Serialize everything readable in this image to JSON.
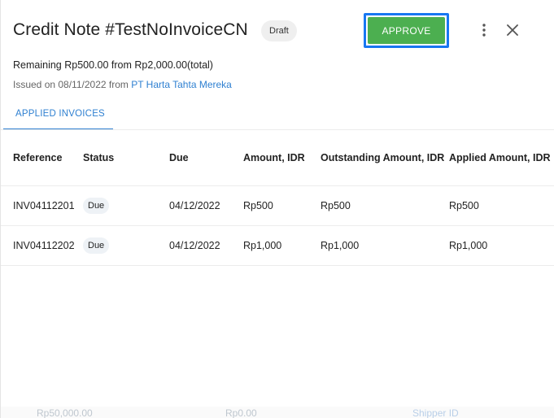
{
  "header": {
    "title": "Credit Note #TestNoInvoiceCN",
    "status_badge": "Draft",
    "approve_label": "APPROVE"
  },
  "summary": {
    "remaining": "Remaining Rp500.00 from Rp2,000.00(total)",
    "issued_prefix": "Issued on 08/11/2022 from ",
    "issuer": "PT Harta Tahta Mereka"
  },
  "tabs": [
    {
      "label": "APPLIED INVOICES",
      "active": true
    }
  ],
  "table": {
    "headers": {
      "reference": "Reference",
      "status": "Status",
      "due": "Due",
      "amount": "Amount, IDR",
      "outstanding": "Outstanding Amount, IDR",
      "applied": "Applied Amount, IDR"
    },
    "rows": [
      {
        "reference": "INV04112201",
        "status": "Due",
        "due": "04/12/2022",
        "amount": "Rp500",
        "outstanding": "Rp500",
        "applied": "Rp500"
      },
      {
        "reference": "INV04112202",
        "status": "Due",
        "due": "04/12/2022",
        "amount": "Rp1,000",
        "outstanding": "Rp1,000",
        "applied": "Rp1,000"
      }
    ]
  },
  "background_row": {
    "col1": "Rp50,000.00",
    "col2": "Rp0.00",
    "col3": "Shipper ID"
  },
  "colors": {
    "approve": "#4caf50",
    "focus_outline": "#1877f2",
    "link": "#2f80d1"
  },
  "icons": {
    "more": "more-vertical-icon",
    "close": "close-icon"
  }
}
